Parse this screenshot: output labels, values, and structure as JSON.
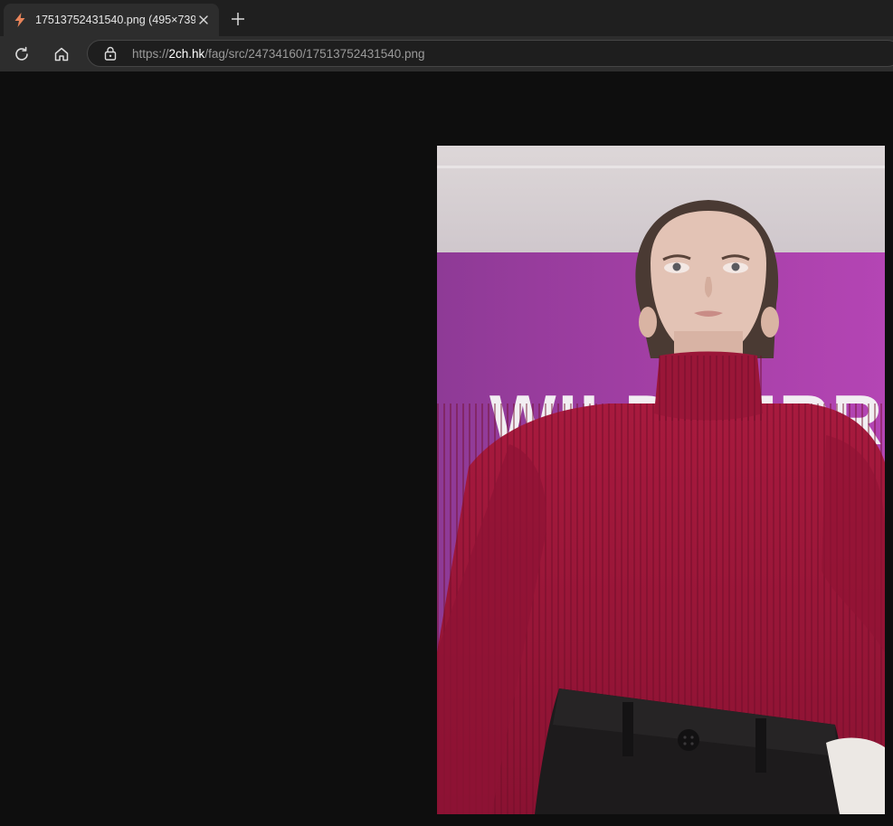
{
  "tab": {
    "title": "17513752431540.png (495×739)",
    "favicon": "lightning-icon"
  },
  "toolbar": {
    "url_prefix": "https://",
    "url_host": "2ch.hk",
    "url_path": "/fag/src/24734160/17513752431540.png"
  },
  "image": {
    "sign_text": "WILDBERRIES"
  },
  "colors": {
    "background": "#0e0e0e",
    "tab_active": "#2d2d2d",
    "wall_purple": "#a53fa6",
    "sweater_red": "#9c1538"
  }
}
